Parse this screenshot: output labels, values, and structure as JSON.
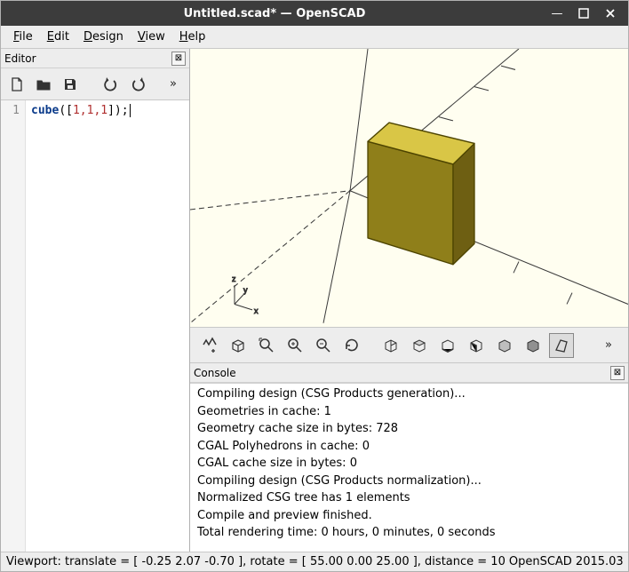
{
  "window": {
    "title": "Untitled.scad* — OpenSCAD"
  },
  "menu": {
    "file": "File",
    "edit": "Edit",
    "design": "Design",
    "view": "View",
    "help": "Help"
  },
  "editor": {
    "title": "Editor",
    "line_num": "1",
    "code": {
      "kw": "cube",
      "open": "([",
      "args": "1,1,1",
      "close": "]);"
    }
  },
  "console": {
    "title": "Console",
    "lines": [
      "Compiling design (CSG Products generation)...",
      "Geometries in cache: 1",
      "Geometry cache size in bytes: 728",
      "CGAL Polyhedrons in cache: 0",
      "CGAL cache size in bytes: 0",
      "Compiling design (CSG Products normalization)...",
      "Normalized CSG tree has 1 elements",
      "Compile and preview finished.",
      "Total rendering time: 0 hours, 0 minutes, 0 seconds"
    ]
  },
  "status": {
    "viewport": "Viewport: translate = [ -0.25 2.07 -0.70 ], rotate = [ 55.00 0.00 25.00 ], distance = 10",
    "version": "OpenSCAD 2015.03"
  },
  "icons": {
    "minimize": "—",
    "maximize": "□",
    "close": "✕",
    "panel_close": "⊠",
    "chev": "»"
  }
}
